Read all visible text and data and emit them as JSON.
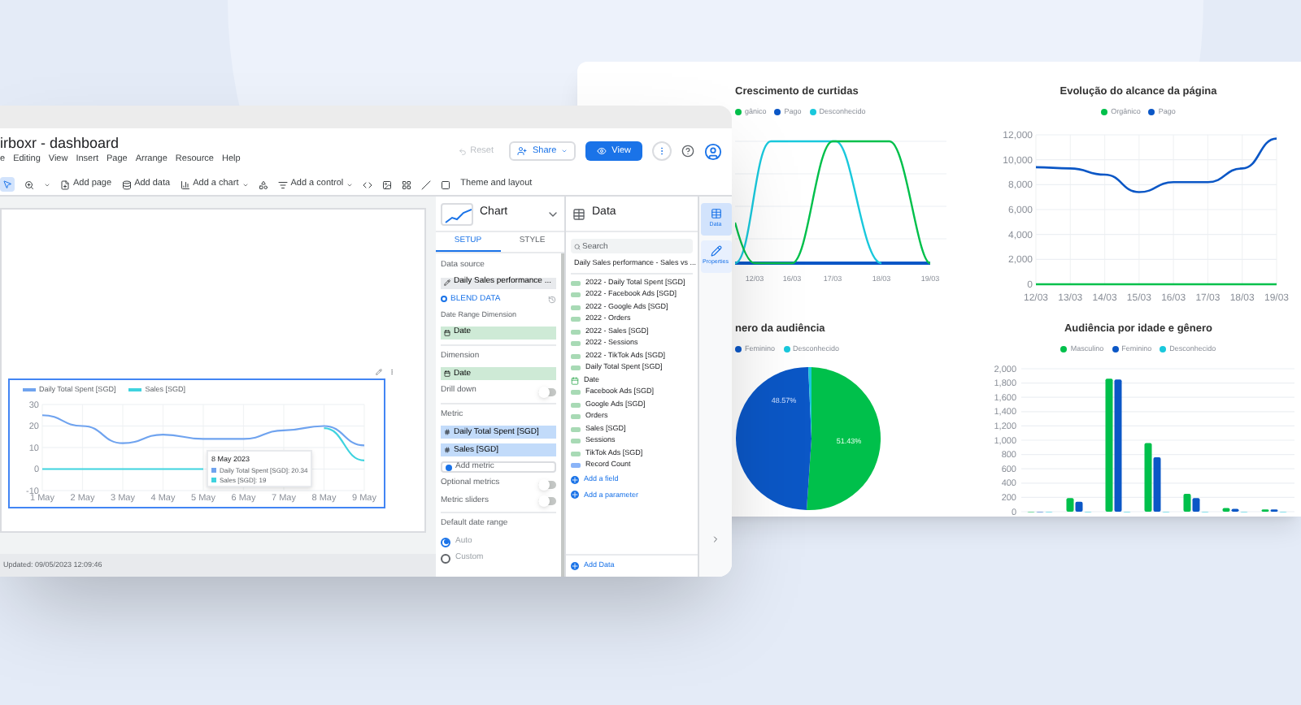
{
  "report": {
    "growth": {
      "title": "Crescimento de curtidas",
      "legend": [
        {
          "label": "gânico",
          "color": "#00c04b"
        },
        {
          "label": "Pago",
          "color": "#0b57c6"
        },
        {
          "label": "Desconhecido",
          "color": "#19c8dc"
        }
      ],
      "x_labels": [
        "12/03",
        "16/03",
        "17/03",
        "18/03",
        "19/03"
      ]
    },
    "reach": {
      "title": "Evolução do alcance da página",
      "chart_data": {
        "type": "line",
        "categories": [
          "12/03",
          "13/03",
          "14/03",
          "15/03",
          "16/03",
          "17/03",
          "18/03",
          "19/03"
        ],
        "ylim": [
          0,
          12000
        ],
        "grid": true,
        "yticks": [
          {
            "value": 0,
            "label": "0"
          },
          {
            "value": 2000,
            "label": "2,000"
          },
          {
            "value": 4000,
            "label": "4,000"
          },
          {
            "value": 6000,
            "label": "6,000"
          },
          {
            "value": 8000,
            "label": "8,000"
          },
          {
            "value": 10000,
            "label": "10,000"
          },
          {
            "value": 12000,
            "label": "12,000"
          }
        ],
        "series": [
          {
            "name": "Orgânico",
            "color": "#00c04b",
            "values": [
              0,
              0,
              0,
              0,
              0,
              0,
              0,
              0
            ]
          },
          {
            "name": "Pago",
            "color": "#0b57c6",
            "values": [
              9400,
              9300,
              8800,
              7400,
              8200,
              8200,
              9300,
              11700
            ]
          }
        ]
      }
    },
    "gender": {
      "title": "nero da audiência",
      "legend": [
        {
          "label": "Feminino",
          "color": "#0b57c6"
        },
        {
          "label": "Desconhecido",
          "color": "#19c8dc"
        }
      ],
      "slice_labels": [
        "48.57%",
        "51.43%"
      ]
    },
    "age": {
      "title": "Audiência por idade e gênero",
      "chart_data": {
        "type": "bar",
        "ylim": [
          0,
          2000
        ],
        "grid": true,
        "yticks": [
          {
            "value": 0,
            "label": "0"
          },
          {
            "value": 200,
            "label": "200"
          },
          {
            "value": 400,
            "label": "400"
          },
          {
            "value": 600,
            "label": "600"
          },
          {
            "value": 800,
            "label": "800"
          },
          {
            "value": 1000,
            "label": "1,000"
          },
          {
            "value": 1200,
            "label": "1,200"
          },
          {
            "value": 1400,
            "label": "1,400"
          },
          {
            "value": 1600,
            "label": "1,600"
          },
          {
            "value": 1800,
            "label": "1,800"
          },
          {
            "value": 2000,
            "label": "2,000"
          }
        ],
        "series": [
          {
            "name": "Masculino",
            "color": "#00c04b",
            "values": [
              0,
              190,
              1860,
              960,
              250,
              50,
              30
            ]
          },
          {
            "name": "Feminino",
            "color": "#0b57c6",
            "values": [
              0,
              140,
              1850,
              760,
              190,
              40,
              30
            ]
          },
          {
            "name": "Desconhecido",
            "color": "#19c8dc",
            "values": [
              0,
              0,
              0,
              0,
              0,
              0,
              0
            ]
          }
        ],
        "stacked": false
      }
    }
  },
  "editor": {
    "title": "irboxr - dashboard",
    "menu": [
      "e",
      "Editing",
      "View",
      "Insert",
      "Page",
      "Arrange",
      "Resource",
      "Help"
    ],
    "reset": {
      "label": "Reset",
      "disabled": true
    },
    "share": "Share",
    "view": "View",
    "toolbar": {
      "select_tool": {
        "selected": true
      },
      "add_page": "Add page",
      "add_data": "Add data",
      "add_chart": "Add a chart",
      "add_control": "Add a control",
      "theme": "Theme and layout"
    },
    "canvas": {
      "chart_data": {
        "type": "line",
        "categories": [
          "1 May",
          "2 May",
          "3 May",
          "4 May",
          "5 May",
          "6 May",
          "7 May",
          "8 May",
          "9 May"
        ],
        "ylim": [
          -10,
          30
        ],
        "grid": true,
        "yticks": [
          -10,
          0,
          10,
          20,
          30
        ],
        "series": [
          {
            "name": "Daily Total Spent [SGD]",
            "color": "#6fa3ef",
            "values": [
              25,
              20,
              12,
              16,
              14,
              14,
              18,
              20,
              11
            ]
          },
          {
            "name": "Sales [SGD]",
            "color": "#3fd3df",
            "values": [
              0,
              0,
              0,
              0,
              0,
              null,
              null,
              19,
              4
            ]
          }
        ]
      },
      "tooltip": {
        "title": "8 May 2023",
        "lines": [
          "Daily Total Spent [SGD]: 20.34",
          "Sales [SGD]: 19"
        ]
      },
      "status": "Updated: 09/05/2023 12:09:46"
    },
    "chart_panel": {
      "title": "Chart",
      "tabs": [
        {
          "label": "SETUP",
          "selected": true
        },
        {
          "label": "STYLE",
          "selected": false
        }
      ],
      "data_source_label": "Data source",
      "data_source": "Daily Sales performance ...",
      "blend": "BLEND DATA",
      "date_range_label": "Date Range Dimension",
      "date_range": "Date",
      "dimension_label": "Dimension",
      "dimension": "Date",
      "drill_down": {
        "label": "Drill down",
        "on": false
      },
      "metric_label": "Metric",
      "metrics": [
        "Daily Total Spent [SGD]",
        "Sales [SGD]"
      ],
      "add_metric": "Add metric",
      "optional_metrics": {
        "label": "Optional metrics",
        "on": false
      },
      "metric_sliders": {
        "label": "Metric sliders",
        "on": false
      },
      "default_range_label": "Default date range",
      "date_options": [
        {
          "label": "Auto",
          "selected": true
        },
        {
          "label": "Custom",
          "selected": false
        }
      ]
    },
    "data_panel": {
      "title": "Data",
      "search": {
        "placeholder": "Search"
      },
      "source": "Daily Sales performance - Sales vs ...",
      "fields": [
        {
          "kind": "number",
          "label": "2022 - Daily Total Spent [SGD]"
        },
        {
          "kind": "number",
          "label": "2022 - Facebook Ads [SGD]"
        },
        {
          "kind": "number",
          "label": "2022 - Google Ads [SGD]"
        },
        {
          "kind": "number",
          "label": "2022 - Orders"
        },
        {
          "kind": "number",
          "label": "2022 - Sales [SGD]"
        },
        {
          "kind": "number",
          "label": "2022 - Sessions"
        },
        {
          "kind": "number",
          "label": "2022 - TikTok Ads [SGD]"
        },
        {
          "kind": "number",
          "label": "Daily Total Spent [SGD]"
        },
        {
          "kind": "date",
          "label": "Date"
        },
        {
          "kind": "number",
          "label": "Facebook Ads [SGD]"
        },
        {
          "kind": "number",
          "label": "Google Ads [SGD]"
        },
        {
          "kind": "number",
          "label": "Orders"
        },
        {
          "kind": "number",
          "label": "Sales [SGD]"
        },
        {
          "kind": "number",
          "label": "Sessions"
        },
        {
          "kind": "number",
          "label": "TikTok Ads [SGD]"
        },
        {
          "kind": "count",
          "label": "Record Count"
        }
      ],
      "add_field": "Add a field",
      "add_parameter": "Add a parameter",
      "add_data": "Add Data"
    },
    "side_tabs": [
      {
        "label": "Data",
        "selected": true
      },
      {
        "label": "Properties",
        "selected": false
      }
    ]
  }
}
